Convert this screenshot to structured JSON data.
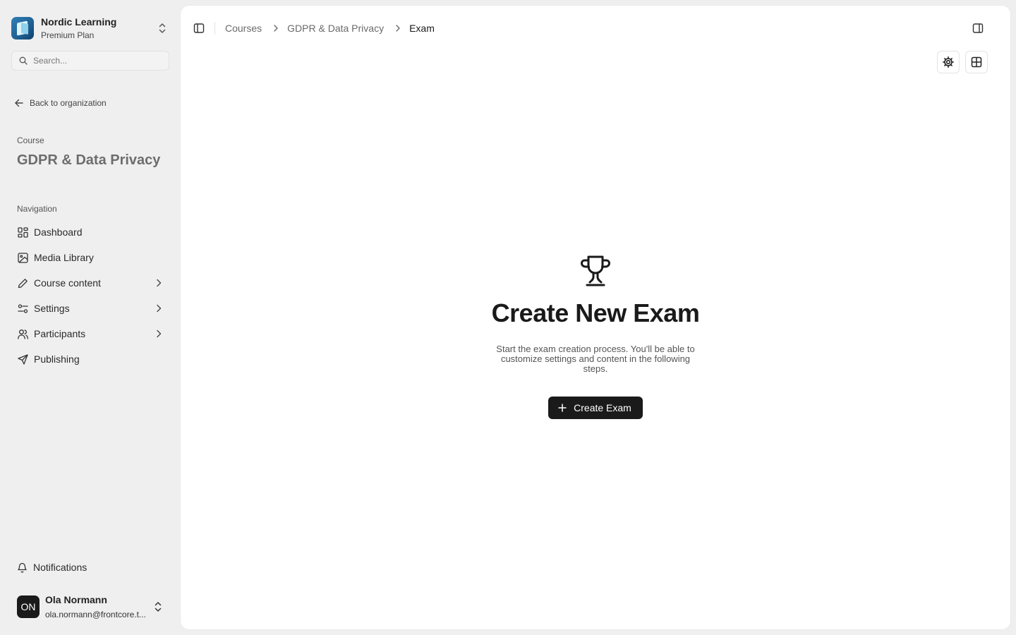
{
  "organization": {
    "name": "Nordic Learning",
    "plan": "Premium Plan"
  },
  "search": {
    "placeholder": "Search..."
  },
  "back_link": "Back to organization",
  "course": {
    "label": "Course",
    "title": "GDPR & Data Privacy"
  },
  "navigation": {
    "label": "Navigation",
    "items": [
      {
        "label": "Dashboard",
        "icon": "dashboard-icon",
        "has_children": false
      },
      {
        "label": "Media Library",
        "icon": "image-icon",
        "has_children": false
      },
      {
        "label": "Course content",
        "icon": "pencil-icon",
        "has_children": true
      },
      {
        "label": "Settings",
        "icon": "sliders-icon",
        "has_children": true
      },
      {
        "label": "Participants",
        "icon": "users-icon",
        "has_children": true
      },
      {
        "label": "Publishing",
        "icon": "send-icon",
        "has_children": false
      }
    ]
  },
  "notifications": "Notifications",
  "user": {
    "initials": "ON",
    "name": "Ola Normann",
    "email": "ola.normann@frontcore.t..."
  },
  "breadcrumb": {
    "items": [
      "Courses",
      "GDPR & Data Privacy"
    ],
    "current": "Exam"
  },
  "empty_state": {
    "title": "Create New Exam",
    "description": "Start the exam creation process. You'll be able to customize settings and content in the following steps.",
    "button_label": "Create Exam"
  }
}
